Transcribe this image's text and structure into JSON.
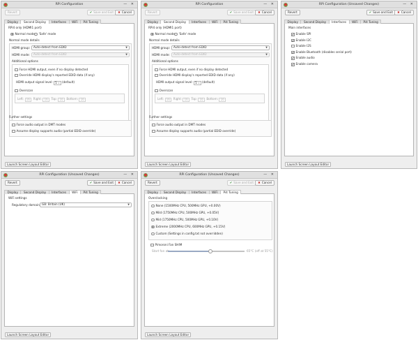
{
  "titles": {
    "plain": "RPi Configuration",
    "unsaved": "RPi Configuration (Unsaved Changes)"
  },
  "buttons": {
    "revert": "Revert",
    "save": "Save and Exit",
    "cancel": "Cancel",
    "launch": "Launch Screen Layout Editor"
  },
  "window_controls": "— ✕",
  "tabs": [
    "Display",
    "Second Display",
    "Interfaces",
    "WiFi",
    "Pi4 Tuning"
  ],
  "second_display": {
    "section_title": "RPi4 only (HDMI1 port)",
    "normal_mode": "Normal mode",
    "safe_mode": "'Safe' mode",
    "normal_details": "Normal mode details",
    "hdmi_group_label": "HDMI group:",
    "hdmi_group_value": "Auto-detect from EDID",
    "hdmi_mode_label": "HDMI mode:",
    "hdmi_mode_value": "Auto-detect from EDID",
    "additional_options": "Additional options",
    "force_hdmi": "Force HDMI output, even if no display detected",
    "override_edid": "Override HDMI display's reported EDID data (if any)",
    "signal_label": "HDMI output signal level:",
    "signal_value": "5",
    "signal_suffix": "(default)",
    "overscan": "Overscan",
    "left": "Left:",
    "right": "Right:",
    "top": "Top:",
    "bottom": "Bottom:",
    "os_left": "16",
    "os_right": "16",
    "os_top": "16",
    "os_bottom": "16",
    "further": "Further settings",
    "force_audio": "Force audio output in DMT modes",
    "assume_audio": "Assume display supports audio (partial EDID override)"
  },
  "interfaces": {
    "title": "Main interfaces",
    "items": [
      {
        "label": "Enable SPI",
        "checked": true
      },
      {
        "label": "Enable I2C",
        "checked": true
      },
      {
        "label": "Enable I2S",
        "checked": false
      },
      {
        "label": "Enable Bluetooth (disables serial port)",
        "checked": true
      },
      {
        "label": "Enable audio",
        "checked": true
      },
      {
        "label": "Enable camera",
        "checked": true
      }
    ]
  },
  "wifi": {
    "title": "WiFi settings",
    "domain_label": "Regulatory domain:",
    "domain_value": "GB: Britain (UK)"
  },
  "pi4": {
    "title": "Overclocking",
    "options": [
      {
        "label": "None (1500MHz CPU, 500MHz GPU, +0.00V)",
        "selected": false
      },
      {
        "label": "Mild (1750MHz CPU, 500MHz GPU, +0.05V)",
        "selected": false
      },
      {
        "label": "Mid (1750MHz CPU, 500MHz GPU, +0.10V)",
        "selected": false
      },
      {
        "label": "Extreme (2000MHz CPU, 600MHz GPU, +0.15V)",
        "selected": true
      },
      {
        "label": "Custom (Settings in config.txt not overridden)",
        "selected": false
      }
    ],
    "fan_label": "Pimoroni Fan SHIM",
    "fan_left": "Start fan at:",
    "fan_right": "65°C (off at 55°C)",
    "fan_fraction": 0.55
  }
}
